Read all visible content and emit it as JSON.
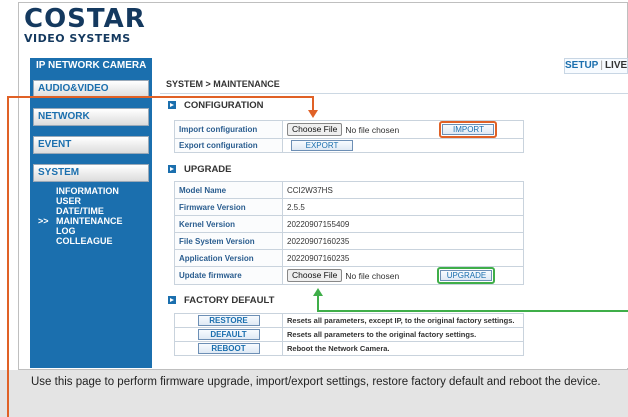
{
  "logo": {
    "brand": "COSTAR",
    "subtitle": "VIDEO SYSTEMS"
  },
  "header": {
    "product": "IP NETWORK CAMERA",
    "setup": "SETUP",
    "separator": "|",
    "live": "LIVE"
  },
  "sidebar": {
    "menus": [
      "AUDIO&VIDEO",
      "NETWORK",
      "EVENT",
      "SYSTEM"
    ],
    "system_items": [
      "INFORMATION",
      "USER",
      "DATE/TIME",
      "MAINTENANCE",
      "LOG",
      "COLLEAGUE"
    ],
    "active_item": "MAINTENANCE"
  },
  "breadcrumb": "SYSTEM > MAINTENANCE",
  "configuration": {
    "title": "CONFIGURATION",
    "import_label": "Import configuration",
    "choose_file": "Choose File",
    "no_file": "No file chosen",
    "import_button": "IMPORT",
    "export_label": "Export configuration",
    "export_button": "EXPORT"
  },
  "upgrade": {
    "title": "UPGRADE",
    "rows": [
      {
        "label": "Model Name",
        "value": "CCI2W37HS"
      },
      {
        "label": "Firmware Version",
        "value": "2.5.5"
      },
      {
        "label": "Kernel Version",
        "value": "20220907155409"
      },
      {
        "label": "File System Version",
        "value": "20220907160235"
      },
      {
        "label": "Application Version",
        "value": "20220907160235"
      }
    ],
    "update_label": "Update firmware",
    "choose_file": "Choose File",
    "no_file": "No file chosen",
    "upgrade_button": "UPGRADE"
  },
  "factory_default": {
    "title": "FACTORY DEFAULT",
    "rows": [
      {
        "button": "RESTORE",
        "desc": "Resets all parameters, except IP, to the original factory settings."
      },
      {
        "button": "DEFAULT",
        "desc": "Resets all parameters to the original factory settings."
      },
      {
        "button": "REBOOT",
        "desc": "Reboot the Network Camera."
      }
    ]
  },
  "caption": "Use this page to perform firmware upgrade, import/export settings, restore factory default and reboot the device.",
  "colors": {
    "accent": "#1b6fae",
    "callout_orange": "#e06126",
    "callout_green": "#3fae49"
  }
}
